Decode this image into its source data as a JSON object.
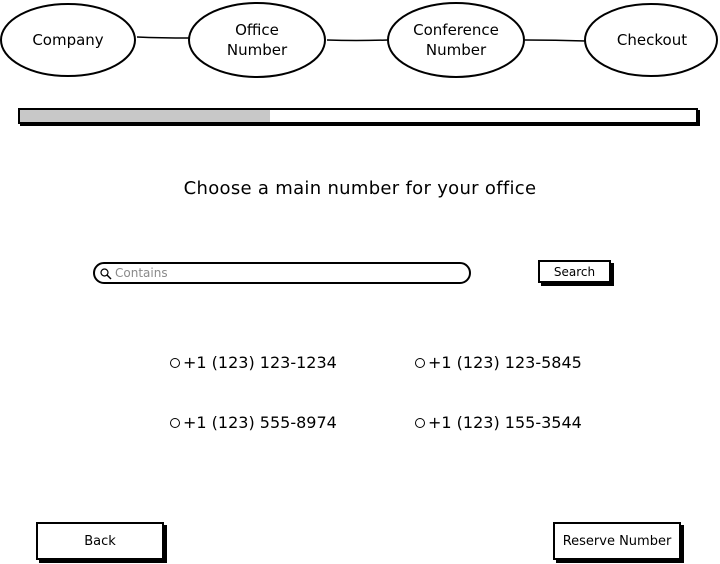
{
  "steps": [
    {
      "label": "Company"
    },
    {
      "label": "Office\nNumber"
    },
    {
      "label": "Conference\nNumber"
    },
    {
      "label": "Checkout"
    }
  ],
  "progress": {
    "fraction": 0.37
  },
  "title": "Choose a main number for your office",
  "search": {
    "placeholder": "Contains",
    "value": "",
    "button_label": "Search"
  },
  "numbers": [
    {
      "label": "+1 (123) 123-1234"
    },
    {
      "label": "+1 (123) 123-5845"
    },
    {
      "label": "+1 (123) 555-8974"
    },
    {
      "label": "+1 (123) 155-3544"
    }
  ],
  "footer": {
    "back_label": "Back",
    "reserve_label": "Reserve Number"
  },
  "icons": {
    "search": "search-icon",
    "radio": "radio-icon"
  }
}
